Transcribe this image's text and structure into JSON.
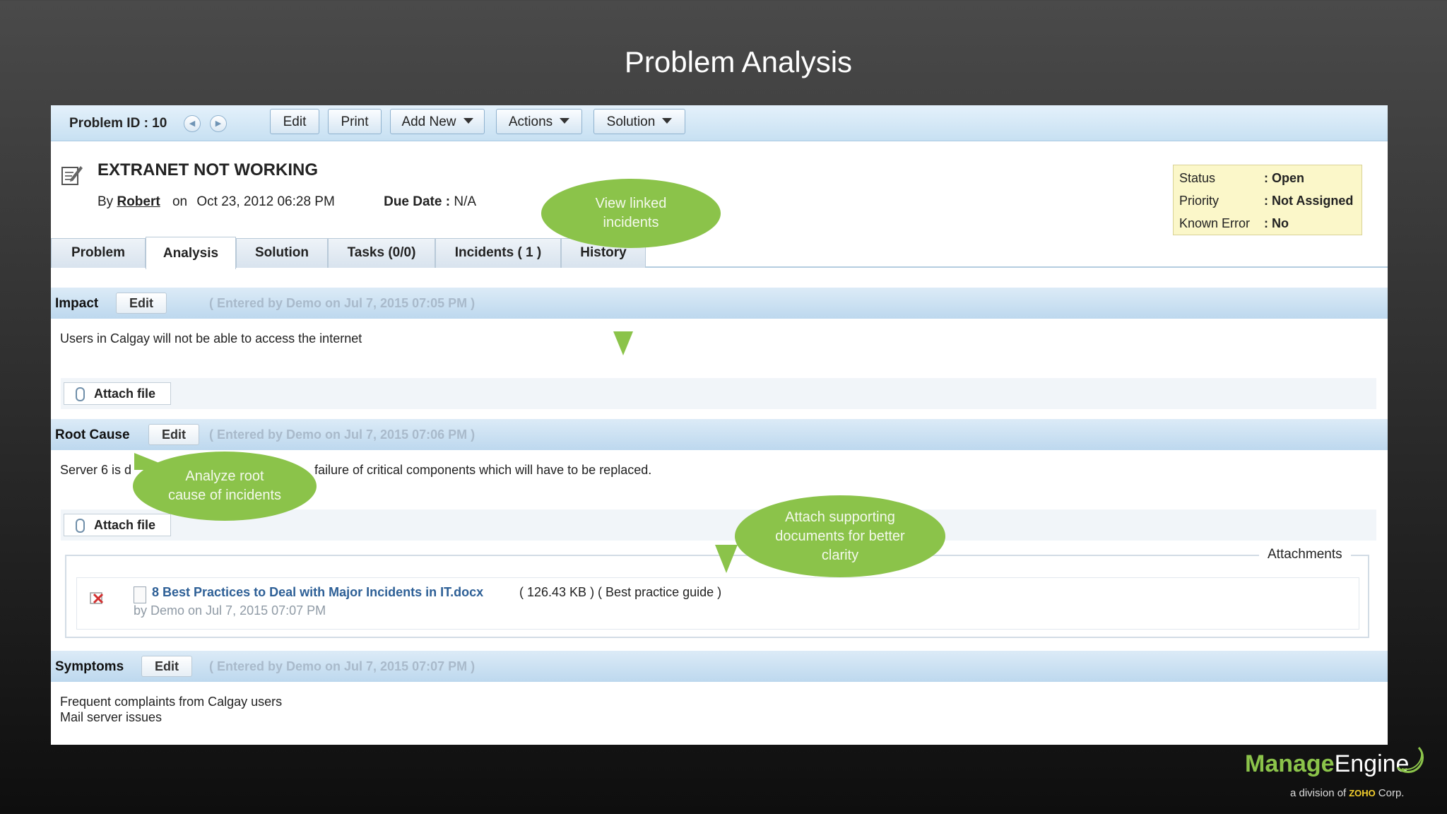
{
  "slide": {
    "title": "Problem Analysis"
  },
  "toolbar": {
    "problem_id": "Problem ID : 10",
    "buttons": {
      "edit": "Edit",
      "print": "Print",
      "add_new": "Add New",
      "actions": "Actions",
      "solution": "Solution"
    }
  },
  "record": {
    "title": "EXTRANET NOT WORKING",
    "by_label": "By",
    "author": "Robert",
    "on_label": "on",
    "created": "Oct 23, 2012 06:28 PM",
    "due_label": "Due Date :",
    "due_value": "N/A"
  },
  "status_box": {
    "rows": [
      {
        "label": "Status",
        "value": ": Open"
      },
      {
        "label": "Priority",
        "value": ": Not Assigned"
      },
      {
        "label": "Known Error",
        "value": ": No"
      }
    ]
  },
  "tabs": [
    {
      "label": "Problem"
    },
    {
      "label": "Analysis",
      "active": true
    },
    {
      "label": "Solution"
    },
    {
      "label": "Tasks (0/0)"
    },
    {
      "label": "Incidents ( 1 )"
    },
    {
      "label": "History"
    }
  ],
  "sections": {
    "impact": {
      "name": "Impact",
      "edit_label": "Edit",
      "meta": "( Entered by Demo on Jul 7, 2015 07:05 PM )",
      "text": "Users in Calgay will not be able to access the internet",
      "attach_label": "Attach file"
    },
    "root_cause": {
      "name": "Root Cause",
      "edit_label": "Edit",
      "meta": "( Entered by Demo on Jul 7, 2015 07:06 PM )",
      "text_start": "Server 6 is d",
      "text_end": "failure of critical components which will have to be replaced.",
      "attach_label": "Attach file"
    },
    "attachments": {
      "legend": "Attachments",
      "file_name": "8 Best Practices to Deal with Major Incidents in IT.docx",
      "file_info": "( 126.43 KB ) ( Best practice guide )",
      "file_meta": "by Demo on Jul 7, 2015 07:07 PM"
    },
    "symptoms": {
      "name": "Symptoms",
      "edit_label": "Edit",
      "meta": "( Entered by Demo on Jul 7, 2015 07:07 PM )",
      "lines": [
        "Frequent complaints from Calgay users",
        "Mail server issues"
      ]
    }
  },
  "callouts": {
    "linked": [
      "View linked",
      "incidents"
    ],
    "root": [
      "Analyze root",
      "cause of incidents"
    ],
    "attach": [
      "Attach supporting",
      "documents for better",
      "clarity"
    ]
  },
  "colors": {
    "callout": "#8bc34a",
    "header_blue": "#c7e0f2",
    "status_box": "#fbf7c9",
    "link": "#2d5f96"
  },
  "branding": {
    "manage": "Manage",
    "engine": "Engine",
    "division_prefix": "a division of",
    "zoho": "ZOHO",
    "corp": "Corp."
  }
}
